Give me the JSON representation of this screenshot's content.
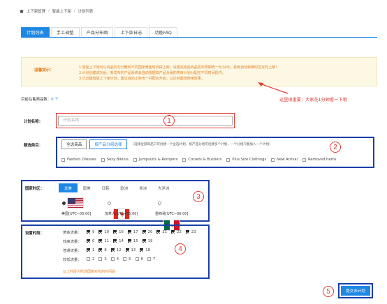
{
  "breadcrumb": {
    "items": [
      "上下架管理",
      "智能上下架",
      "计划列表"
    ]
  },
  "tabs": [
    "计划列表",
    "手工调整",
    "产品分布图",
    "上下架日志",
    "功能FAQ"
  ],
  "notice": {
    "label": "温馨提示：",
    "lines": [
      "1.智能上下架可让商品均匀分散到不同国家黄金时间段上架，设置完成后商品发布周期统一为14天，系统自动转换时区定时上架！",
      "2.计划创建成功后，新发布的产品系统会自动根据其产品分组的类目计划分配在不同时间段内。",
      "3.已创建智能上下架计划，建议自动上架也一并配合开启，以达到最佳使用效果。"
    ]
  },
  "annotation_text": "这里很重要，大家花1分钟看一下哦",
  "existing": {
    "label": "目前在售商品数：",
    "value": "0 个"
  },
  "plan_name": {
    "label": "计划名称：",
    "placeholder": "计划名称"
  },
  "category": {
    "label": "精选类目：",
    "btn_all": "全选商品",
    "btn_group": "按产品分组选择",
    "hint": "（选择全部商品只可创建一个全选计划，按产品分组可创建多个计划，一个分组只能加入一个计划）",
    "items": [
      "Fashion Dresses",
      "Sexy Bikinis",
      "Jumpsuits & Rompers",
      "Corsets & Bustiers",
      "Plus Size Clothings",
      "New Arrival",
      "Removed Items"
    ]
  },
  "region": {
    "label": "国家时区：",
    "tabs": [
      "北美",
      "南美",
      "日韩",
      "欧洲",
      "非洲",
      "大洋洲"
    ],
    "countries": [
      {
        "name": "美国[UTC−05:00]",
        "selected": true
      },
      {
        "name": "加拿大[UTC−05:00]",
        "selected": false
      },
      {
        "name": "墨西哥[UTC−06:00]",
        "selected": false
      }
    ]
  },
  "times": {
    "label": "设置时段：",
    "rows": [
      {
        "name": "黄金流量：",
        "hours": [
          "9",
          "10",
          "16",
          "17",
          "20",
          "21",
          "22",
          "23"
        ],
        "checked": true
      },
      {
        "name": "较高流量：",
        "hours": [
          "0",
          "11",
          "14",
          "15",
          "19"
        ],
        "checked": true
      },
      {
        "name": "普通流量：",
        "hours": [
          "1",
          "8",
          "12",
          "13",
          "18"
        ],
        "checked": true
      },
      {
        "name": "较低流量：",
        "hours": [
          "2",
          "3",
          "4",
          "5",
          "6",
          "7"
        ],
        "checked": false
      }
    ],
    "note": "以上时段为所选国家对应的时间段"
  },
  "circle_numbers": [
    "1",
    "2",
    "3",
    "4",
    "5"
  ],
  "submit_label": "提交去计划",
  "colors": {
    "accent": "#1e88e5",
    "annotation": "#e53935",
    "notice_bg": "#fcf8e3",
    "frame": "#1a3ea8"
  }
}
